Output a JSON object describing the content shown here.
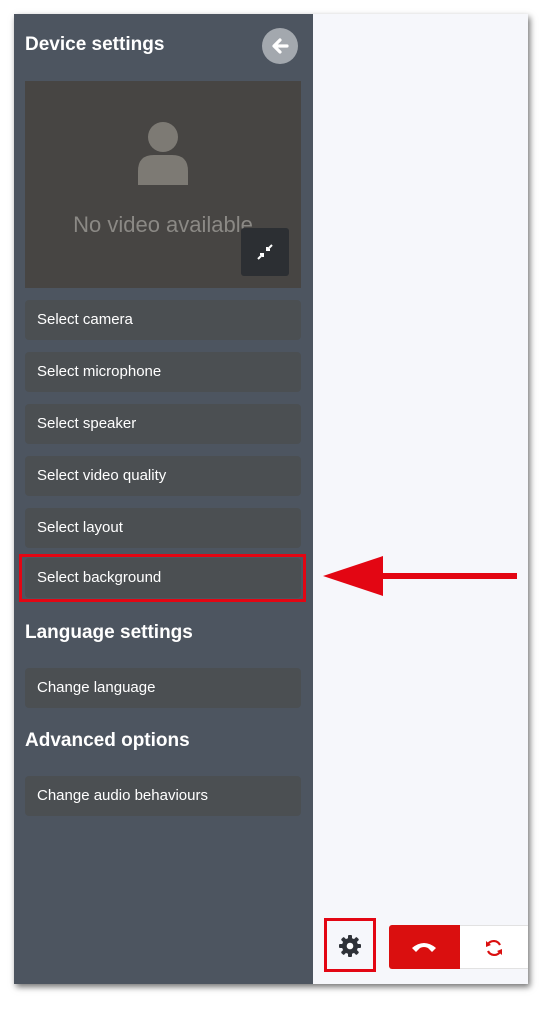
{
  "sidebar": {
    "title": "Device settings",
    "video_preview": {
      "message": "No video available"
    },
    "device_buttons": [
      {
        "label": "Select camera"
      },
      {
        "label": "Select microphone"
      },
      {
        "label": "Select speaker"
      },
      {
        "label": "Select video quality"
      },
      {
        "label": "Select layout"
      },
      {
        "label": "Select background"
      }
    ],
    "language_section": {
      "title": "Language settings",
      "buttons": [
        {
          "label": "Change language"
        }
      ]
    },
    "advanced_section": {
      "title": "Advanced options",
      "buttons": [
        {
          "label": "Change audio behaviours"
        }
      ]
    }
  },
  "toolbar": {
    "icons": [
      "gear-icon",
      "phone-hangup-icon",
      "refresh-icon"
    ]
  },
  "annotations": {
    "highlight_color": "#e30613"
  },
  "colors": {
    "sidebar_bg": "#4d5560",
    "button_bg": "#4b4f52",
    "video_bg": "#474543",
    "hangup_red": "#da0f0f",
    "content_bg": "#f6f7fb"
  }
}
